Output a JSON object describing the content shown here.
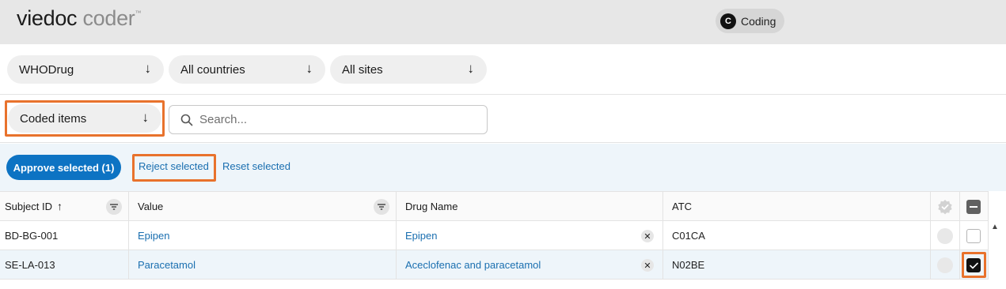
{
  "app": {
    "brand": "viedoc",
    "product": "coder",
    "trademark": "™"
  },
  "user": {
    "initial": "C",
    "label": "Coding"
  },
  "filters": {
    "dictionary": "WHODrug",
    "countries": "All countries",
    "sites": "All sites",
    "item_state": "Coded items",
    "arrow": "↓"
  },
  "search": {
    "placeholder": "Search..."
  },
  "actions": {
    "approve": "Approve selected (1)",
    "reject": "Reject selected",
    "reset": "Reset selected"
  },
  "table": {
    "columns": {
      "subject_id": "Subject ID",
      "value": "Value",
      "drug_name": "Drug Name",
      "atc": "ATC"
    },
    "rows": [
      {
        "subject_id": "BD-BG-001",
        "value": "Epipen",
        "drug_name": "Epipen",
        "atc": "C01CA",
        "selected": false
      },
      {
        "subject_id": "SE-LA-013",
        "value": "Paracetamol",
        "drug_name": "Aceclofenac and paracetamol",
        "atc": "N02BE",
        "selected": true
      }
    ]
  },
  "colors": {
    "accent": "#0d73c3",
    "highlight": "#e8722c",
    "link": "#1a6fb0"
  }
}
